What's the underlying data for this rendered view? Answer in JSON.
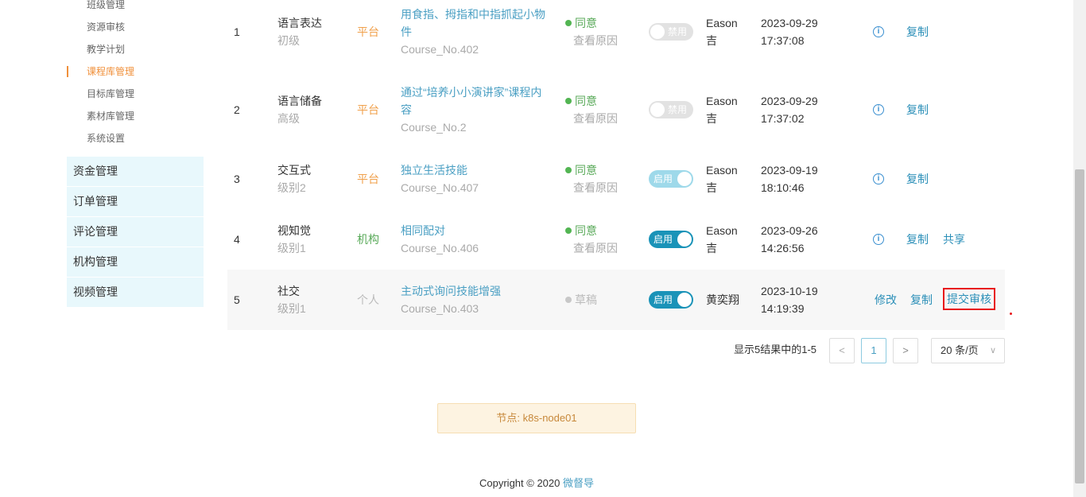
{
  "sidebar": {
    "sub_items": [
      "班级管理",
      "资源审核",
      "教学计划",
      "课程库管理",
      "目标库管理",
      "素材库管理",
      "系统设置"
    ],
    "menu_items": [
      "资金管理",
      "订单管理",
      "评论管理",
      "机构管理",
      "视频管理"
    ]
  },
  "table": {
    "rows": [
      {
        "no": "1",
        "type": "语言表达",
        "level": "初级",
        "source": "平台",
        "title": "用食指、拇指和中指抓起小物件",
        "code": "Course_No.402",
        "status": "同意",
        "reason": "查看原因",
        "switch": "禁用",
        "author_line1": "Eason",
        "author_line2": "吉",
        "date": "2023-09-29",
        "time": "17:37:08",
        "action1": "复制"
      },
      {
        "no": "2",
        "type": "语言储备",
        "level": "高级",
        "source": "平台",
        "title": "通过“培养小小演讲家”课程内容",
        "code": "Course_No.2",
        "status": "同意",
        "reason": "查看原因",
        "switch": "禁用",
        "author_line1": "Eason",
        "author_line2": "吉",
        "date": "2023-09-29",
        "time": "17:37:02",
        "action1": "复制"
      },
      {
        "no": "3",
        "type": "交互式",
        "level": "级别2",
        "source": "平台",
        "title": "独立生活技能",
        "code": "Course_No.407",
        "status": "同意",
        "reason": "查看原因",
        "switch": "启用",
        "author_line1": "Eason",
        "author_line2": "吉",
        "date": "2023-09-19",
        "time": "18:10:46",
        "action1": "复制"
      },
      {
        "no": "4",
        "type": "视知觉",
        "level": "级别1",
        "source": "机构",
        "title": "相同配对",
        "code": "Course_No.406",
        "status": "同意",
        "reason": "查看原因",
        "switch": "启用",
        "author_line1": "Eason",
        "author_line2": "吉",
        "date": "2023-09-26",
        "time": "14:26:56",
        "action1": "复制",
        "action2": "共享"
      },
      {
        "no": "5",
        "type": "社交",
        "level": "级别1",
        "source": "个人",
        "title": "主动式询问技能增强",
        "code": "Course_No.403",
        "status": "草稿",
        "switch": "启用",
        "author_line1": "黄奕翔",
        "date": "2023-10-19",
        "time": "14:19:39",
        "action_edit": "修改",
        "action1": "复制",
        "action_submit": "提交审核"
      }
    ]
  },
  "pagination": {
    "total_text": "显示5结果中的1-5",
    "prev": "<",
    "current": "1",
    "next": ">",
    "page_size": "20 条/页",
    "chevron": "∨"
  },
  "node": "节点: k8s-node01",
  "footer": {
    "copyright": "Copyright © 2020 ",
    "brand": "微督导"
  },
  "icons": {
    "info": "i"
  },
  "colors": {
    "accent": "#1a93b8",
    "active_menu": "#f0903b",
    "highlight_border": "#e8151b"
  }
}
